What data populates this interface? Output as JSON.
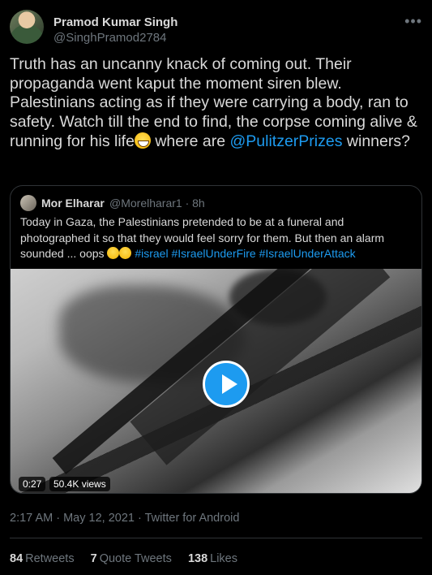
{
  "author": {
    "name": "Pramod Kumar Singh",
    "handle": "@SinghPramod2784"
  },
  "tweet": {
    "text_before_emoji": "Truth has an uncanny knack of coming out. Their propaganda went kaput the moment siren blew. Palestinians acting as if they were carrying a body, ran to safety. Watch till the end to find, the corpse coming alive & running for his life",
    "text_after_emoji": " where are ",
    "mention": "@PulitzerPrizes",
    "text_end": " winners?"
  },
  "quote": {
    "name": "Mor Elharar",
    "handle": "@Morelharar1",
    "separator": " · ",
    "time": "8h",
    "text": "Today in Gaza, the Palestinians pretended to be at a funeral and photographed it so that they would feel sorry for them.  But then an alarm sounded ... oops ",
    "hashtags": [
      "#israel",
      "#IsraelUnderFire",
      "#IsraelUnderAttack"
    ],
    "video": {
      "duration": "0:27",
      "views": "50.4K views"
    }
  },
  "meta": {
    "timestamp": "2:17 AM · May 12, 2021 · Twitter for Android"
  },
  "stats": {
    "retweets_count": "84",
    "retweets_label": "Retweets",
    "quotes_count": "7",
    "quotes_label": "Quote Tweets",
    "likes_count": "138",
    "likes_label": "Likes"
  },
  "icons": {
    "more": "more-horizontal-icon",
    "play": "play-icon"
  },
  "colors": {
    "background": "#000000",
    "text": "#d9d9d9",
    "muted": "#6e767d",
    "link": "#1d9bf0",
    "border": "#2f3336"
  }
}
